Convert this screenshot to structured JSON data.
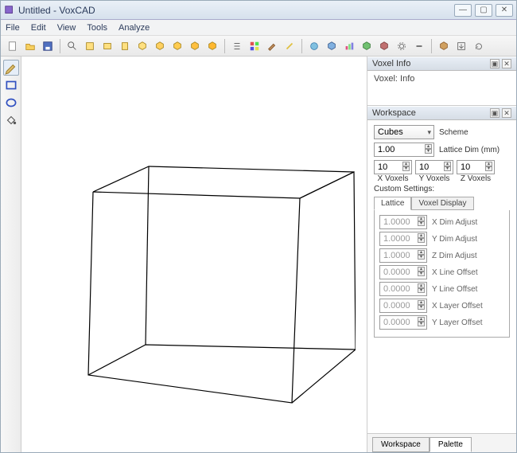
{
  "window": {
    "title": "Untitled - VoxCAD"
  },
  "menus": {
    "file": "File",
    "edit": "Edit",
    "view": "View",
    "tools": "Tools",
    "analyze": "Analyze"
  },
  "panels": {
    "voxel_info": {
      "title": "Voxel Info",
      "content": "Voxel: Info"
    },
    "workspace": {
      "title": "Workspace"
    }
  },
  "workspace": {
    "scheme_value": "Cubes",
    "scheme_label": "Scheme",
    "lattice_dim_value": "1.00",
    "lattice_dim_label": "Lattice Dim (mm)",
    "x_voxels": "10",
    "y_voxels": "10",
    "z_voxels": "10",
    "x_voxels_label": "X Voxels",
    "y_voxels_label": "Y Voxels",
    "z_voxels_label": "Z Voxels",
    "custom_settings_label": "Custom Settings:",
    "tab_lattice": "Lattice",
    "tab_voxel_display": "Voxel Display",
    "settings": [
      {
        "value": "1.0000",
        "label": "X Dim Adjust"
      },
      {
        "value": "1.0000",
        "label": "Y Dim Adjust"
      },
      {
        "value": "1.0000",
        "label": "Z Dim Adjust"
      },
      {
        "value": "0.0000",
        "label": "X Line Offset"
      },
      {
        "value": "0.0000",
        "label": "Y Line Offset"
      },
      {
        "value": "0.0000",
        "label": "X Layer Offset"
      },
      {
        "value": "0.0000",
        "label": "Y Layer Offset"
      }
    ]
  },
  "bottom_tabs": {
    "workspace": "Workspace",
    "palette": "Palette"
  }
}
